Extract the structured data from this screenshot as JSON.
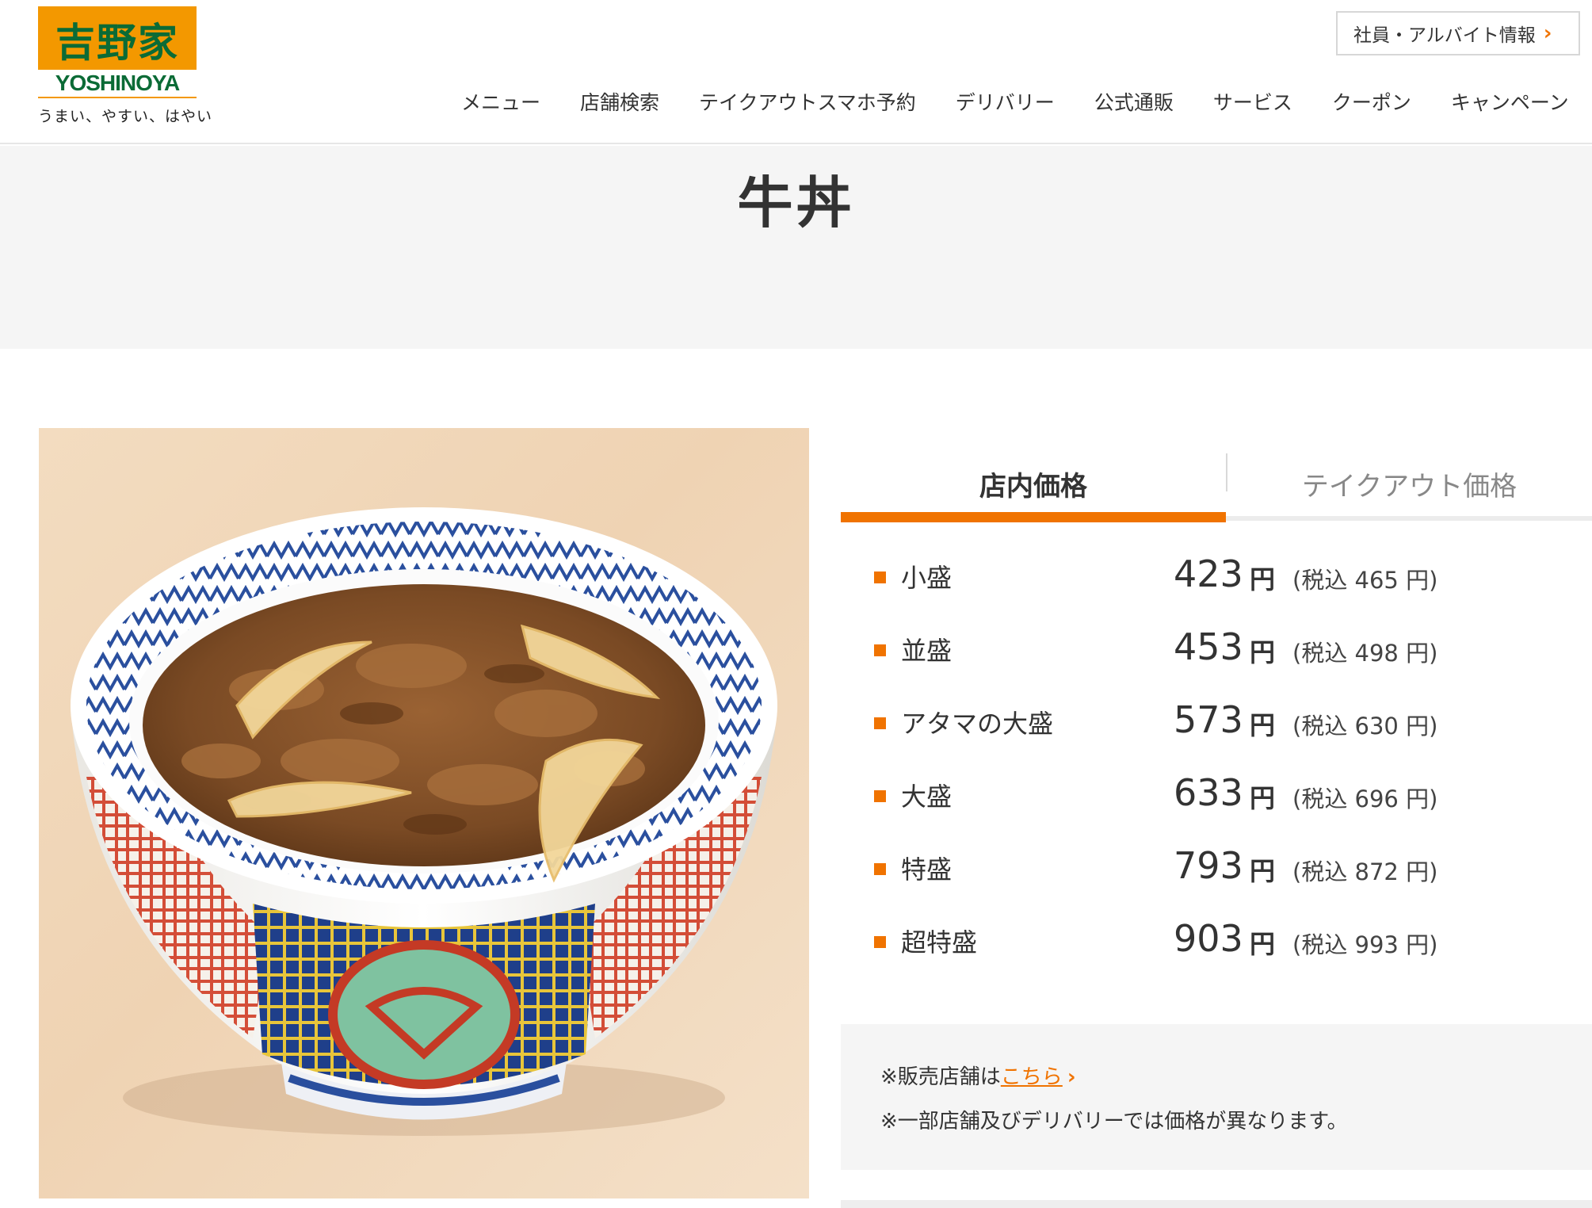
{
  "header": {
    "logo_kanji": "吉野家",
    "logo_romaji": "YOSHINOYA",
    "tagline": "うまい、やすい、はやい",
    "recruit_link": "社員・アルバイト情報",
    "nav": [
      {
        "label": "メニュー"
      },
      {
        "label": "店舗検索"
      },
      {
        "label": "テイクアウトスマホ予約"
      },
      {
        "label": "デリバリー"
      },
      {
        "label": "公式通販"
      },
      {
        "label": "サービス"
      },
      {
        "label": "クーポン"
      },
      {
        "label": "キャンペーン"
      }
    ]
  },
  "page": {
    "title": "牛丼"
  },
  "price_tabs": {
    "in_store": "店内価格",
    "takeout": "テイクアウト価格",
    "active": "in_store"
  },
  "prices": [
    {
      "size": "小盛",
      "price": "423",
      "yen": "円",
      "taxed": "(税込 465 円)"
    },
    {
      "size": "並盛",
      "price": "453",
      "yen": "円",
      "taxed": "(税込 498 円)"
    },
    {
      "size": "アタマの大盛",
      "price": "573",
      "yen": "円",
      "taxed": "(税込 630 円)"
    },
    {
      "size": "大盛",
      "price": "633",
      "yen": "円",
      "taxed": "(税込 696 円)"
    },
    {
      "size": "特盛",
      "price": "793",
      "yen": "円",
      "taxed": "(税込 872 円)"
    },
    {
      "size": "超特盛",
      "price": "903",
      "yen": "円",
      "taxed": "(税込 993 円)"
    }
  ],
  "notes": {
    "stores_prefix": "※販売店舗は",
    "stores_link": "こちら",
    "price_note": "※一部店舗及びデリバリーでは価格が異なります。"
  },
  "colors": {
    "accent": "#f07300",
    "logo_orange": "#f39800",
    "logo_green": "#0b6b36",
    "title_band": "#f5f5f5"
  }
}
